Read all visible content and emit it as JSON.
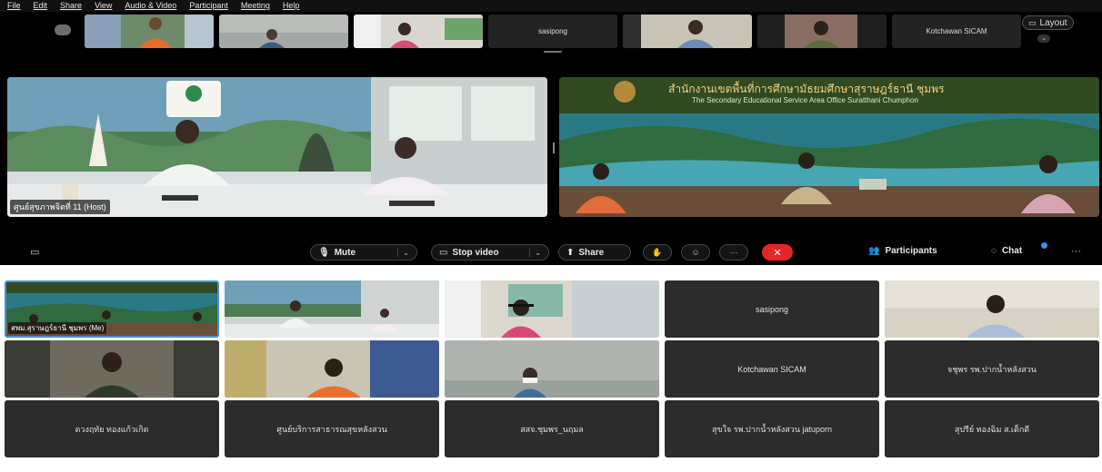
{
  "menu": [
    "File",
    "Edit",
    "Share",
    "View",
    "Audio & Video",
    "Participant",
    "Meeting",
    "Help"
  ],
  "strip": {
    "name_tile_1": "sasipong",
    "name_tile_2": "Kotchawan SICAM",
    "layout_label": "Layout"
  },
  "main": {
    "host_label": "ศูนย์สุขภาพจิตที่ 11 (Host)",
    "banner_thai": "สำนักงานเขตพื้นที่การศึกษามัธยมศึกษาสุราษฎร์ธานี ชุมพร",
    "banner_en": "The Secondary Educational Service Area Office Suratthani Chumphon"
  },
  "toolbar": {
    "mute": "Mute",
    "stop_video": "Stop video",
    "share": "Share",
    "more": "···",
    "participants": "Participants",
    "chat": "Chat",
    "end_icon": "close-icon",
    "end_color": "#e02828",
    "accent": "#3a8dff"
  },
  "gallery": {
    "me_label": "สพม.สุราษฎร์ธานี ชุมพร (Me)",
    "names": {
      "sasipong": "sasipong",
      "kotchawan": "Kotchawan SICAM",
      "chumphon_pak": "จชุพร รพ.ปากน้ำหลังสวน",
      "row3_1": "ดวงฤทัย ทองแก้วเกิด",
      "row3_2": "ศูนย์บริการสาธารณสุขหลังสวน",
      "row3_3": "สสจ.ชุมพร_นฤมล",
      "row3_4": "สุขใจ รพ.ปากน้ำหลังสวน jatuporn",
      "row3_5": "สุปรีย์ ทองฉิม ส.เด็กดี"
    }
  }
}
